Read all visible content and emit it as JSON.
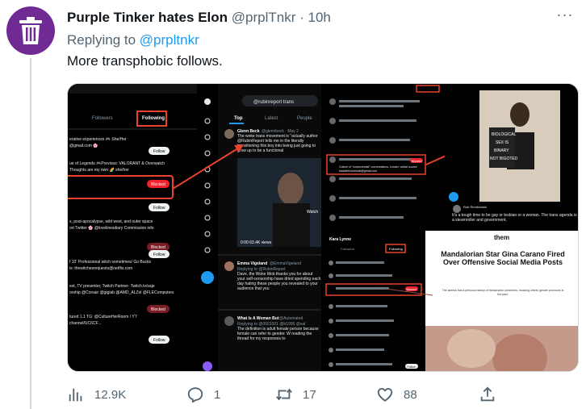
{
  "colors": {
    "accent": "#1d9bf0",
    "avatar_bg": "#6f2a94",
    "annotation": "#e8432e"
  },
  "tweet": {
    "display_name": "Purple Tinker hates Elon",
    "handle": "@prplTnkr",
    "separator": "·",
    "time": "10h",
    "replying_prefix": "Replying to",
    "replying_to": "@prpltnkr",
    "text": "More transphobic follows.",
    "more_icon": "more-dots-icon"
  },
  "media_panel_1": {
    "tab_followers": "Followers",
    "tab_following": "Following",
    "follow_label": "Follow",
    "blocked_label": "Blocked",
    "bios": [
      "erative experiences 🎮 She/Her",
      "@gmail.com 🌸",
      "ue of Legends 🎮Previous: VALORANT & Overwatch",
      "Thoughts are my own 🌈 she/her",
      "s, post-apocalypse, wild west, and outer space",
      "ort Twitter 🌸 @lovelinesdiary Commission info",
      "f 10' Professional witch sometimes/ Go Bucks",
      "is: thewitchesrequests@netflix.com",
      "est, TV presenter, Twitch Partner- Twitch.tv/saje",
      "orship @Corsair @giglab @AMD_ALZsI @FLEComputers",
      "tured 1.1 TG: @CultureHerRoom / YT",
      "channel/UC6CF..."
    ]
  },
  "media_panel_2": {
    "search_text": "@rubinreport trans",
    "tab_top": "Top",
    "tab_latest": "Latest",
    "tab_people": "People",
    "author_1": "Glenn Beck",
    "handle_1": "@glennbeck · May 2",
    "text_1": "The woke trans movement is \"actually author @RubinReport tells me in the literally transitioning this boy into being just going to grow up to be a functional",
    "video_views": "0:00   63.4K views",
    "video_caption": "Watch",
    "author_2": "Emma Vigeland",
    "handle_2": "@EmmaVigeland",
    "replying_2": "Replying to @RubinReport",
    "text_2": "Dave, the Woke Mob thanks you for about your self-censorship have dried spending each day hating these people you revealed to your audience that you",
    "author_3": "What Is A Woman But",
    "handle_3": "@Automated",
    "replying_3": "Replying to @0001001 @b1996 @sal",
    "text_3": "The definition is adult female person because female can refer to gender. W reading the thread for my responses to"
  },
  "media_panel_3": {
    "lines": [
      "Culture of \"controversial\" conversations. Leader: article source",
      "tradwifehomesale@gmail.com"
    ],
    "blocked_label": "Blocked"
  },
  "media_panel_4": {
    "sign_lines": [
      "BIOLOGICAL",
      "SEX IS",
      "BINARY",
      "NOT BIGOTED"
    ],
    "reply_name": "Rob Rembowski",
    "reply_text": "It's a tough time to be gay or lesbian or a woman. The trans agenda is a steamroller and government,"
  },
  "media_panel_5": {
    "name": "Kara Lynne",
    "tab_followers": "Followers",
    "tab_following": "Following",
    "follow_label": "Follow",
    "blocked_label": "Blocked"
  },
  "media_panel_6": {
    "brand": "them",
    "headline": "Mandalorian Star Gina Carano Fired Over Offensive Social Media Posts",
    "subhead": "The actress has a previous history of transphobic comments, mocking others' gender pronouns in the past."
  },
  "actions": {
    "views": "12.9K",
    "replies": "1",
    "retweets": "17",
    "likes": "88",
    "views_icon": "analytics-icon",
    "reply_icon": "reply-icon",
    "retweet_icon": "retweet-icon",
    "like_icon": "heart-icon",
    "share_icon": "share-icon"
  }
}
